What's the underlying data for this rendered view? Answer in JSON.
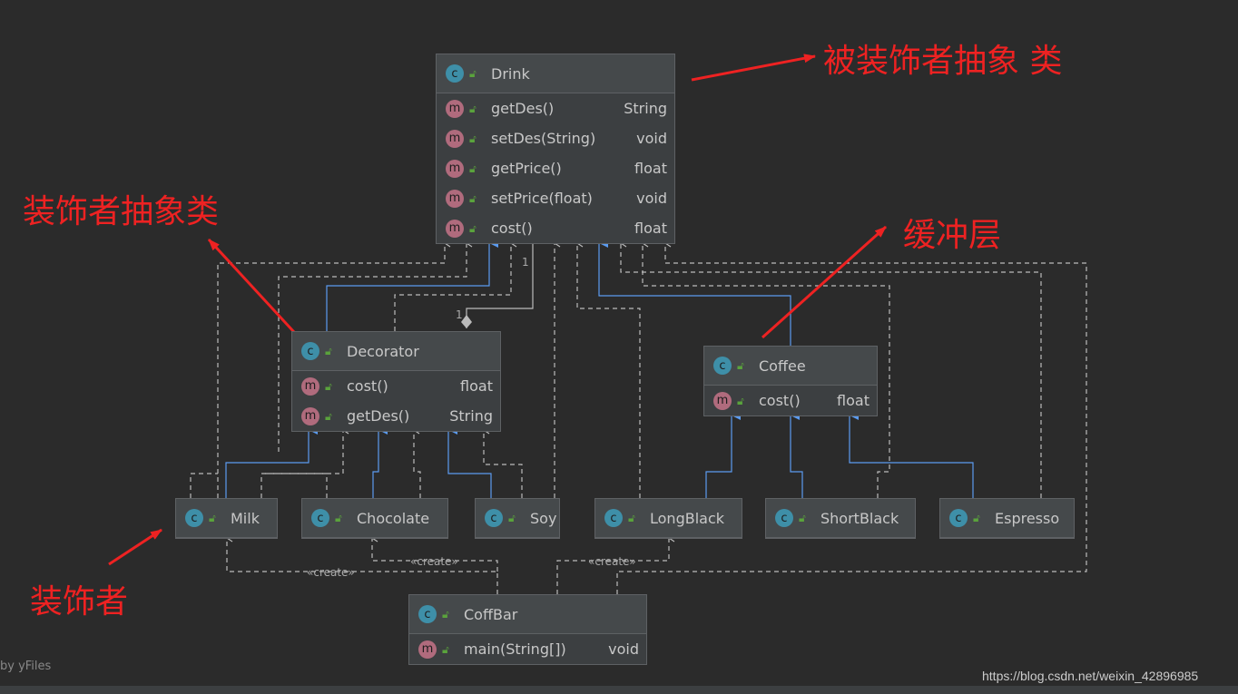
{
  "classes": [
    {
      "id": "drink",
      "name": "Drink",
      "methods": [
        [
          "getDes()",
          "String"
        ],
        [
          "setDes(String)",
          "void"
        ],
        [
          "getPrice()",
          "float"
        ],
        [
          "setPrice(float)",
          "void"
        ],
        [
          "cost()",
          "float"
        ]
      ]
    },
    {
      "id": "decorator",
      "name": "Decorator",
      "methods": [
        [
          "cost()",
          "float"
        ],
        [
          "getDes()",
          "String"
        ]
      ]
    },
    {
      "id": "coffee",
      "name": "Coffee",
      "methods": [
        [
          "cost()",
          "float"
        ]
      ]
    },
    {
      "id": "milk",
      "name": "Milk",
      "methods": []
    },
    {
      "id": "chocolate",
      "name": "Chocolate",
      "methods": []
    },
    {
      "id": "soy",
      "name": "Soy",
      "methods": []
    },
    {
      "id": "longblack",
      "name": "LongBlack",
      "methods": []
    },
    {
      "id": "shortblack",
      "name": "ShortBlack",
      "methods": []
    },
    {
      "id": "espresso",
      "name": "Espresso",
      "methods": []
    },
    {
      "id": "coffbar",
      "name": "CoffBar",
      "methods": [
        [
          "main(String[])",
          "void"
        ]
      ]
    }
  ],
  "labels": {
    "create": "«create»",
    "mult1": "1",
    "mult2": "1"
  },
  "annotations": {
    "drink": "被装饰者抽象 类",
    "decorator": "装饰者抽象类",
    "coffee": "缓冲层",
    "concrete": "装饰者"
  },
  "footer": {
    "watermark": "by yFiles",
    "url": "https://blog.csdn.net/weixin_42896985"
  },
  "colors": {
    "background": "#2b2b2b",
    "annotation": "#ee2222",
    "inherit": "#5b9bf0",
    "dependency": "#bbbbbb"
  }
}
